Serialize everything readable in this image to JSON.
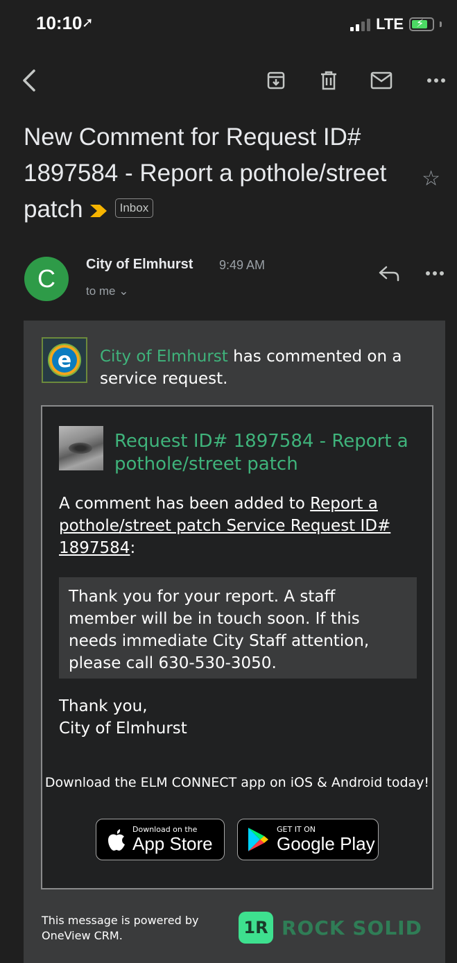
{
  "status_bar": {
    "time": "10:10",
    "network": "LTE"
  },
  "subject": {
    "text": "New Comment for Request ID# 1897584 - Report a pothole/street patch",
    "label": "Inbox"
  },
  "sender": {
    "avatar_letter": "C",
    "name": "City of Elmhurst",
    "time": "9:49 AM",
    "to": "to me ⌄"
  },
  "body": {
    "intro_name": "City of Elmhurst",
    "intro_rest": " has commented on a service request.",
    "logo_letter": "e",
    "request_title": "Request ID# 1897584 - Report a pothole/street patch",
    "comment_prefix": "A comment has been added to ",
    "comment_link": "Report a pothole/street patch Service Request ID# 1897584",
    "comment_suffix": ":",
    "quote": "Thank you for your report. A staff member will be in touch soon. If this needs immediate City Staff attention, please call 630-530-3050.",
    "signoff_line1": "Thank you,",
    "signoff_line2": "City of Elmhurst",
    "download_text": "Download the ELM CONNECT app on iOS & Android today!",
    "appstore_small": "Download on the",
    "appstore_big": "App Store",
    "gplay_small": "GET IT ON",
    "gplay_big": "Google Play",
    "powered_by": "This message is powered by OneView CRM.",
    "rocksolid_badge": "1R",
    "rocksolid_text": "ROCK SOLID"
  },
  "colors": {
    "background": "#1f1f1f",
    "accent_green": "#3fb37b",
    "avatar": "#2e9b48",
    "importance": "#f6b400"
  }
}
